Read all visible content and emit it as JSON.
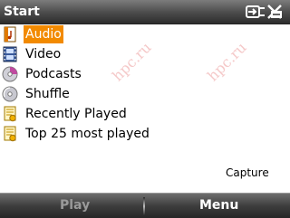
{
  "title_bar": {
    "title": "Start",
    "icons": [
      "connectivity-icon",
      "close-icon"
    ]
  },
  "menu": {
    "items": [
      {
        "label": "Audio",
        "icon": "audio-file-icon",
        "selected": true
      },
      {
        "label": "Video",
        "icon": "video-film-icon",
        "selected": false
      },
      {
        "label": "Podcasts",
        "icon": "podcast-cd-icon",
        "selected": false
      },
      {
        "label": "Shuffle",
        "icon": "shuffle-cd-icon",
        "selected": false
      },
      {
        "label": "Recently Played",
        "icon": "playlist-icon",
        "selected": false
      },
      {
        "label": "Top 25 most played",
        "icon": "playlist-icon",
        "selected": false
      }
    ]
  },
  "capture_label": "Capture",
  "softkeys": {
    "left": "Play",
    "right": "Menu"
  },
  "watermark_text": "hpc.ru",
  "colors": {
    "selection": "#f28a00",
    "watermark": "#f4c4c4"
  }
}
